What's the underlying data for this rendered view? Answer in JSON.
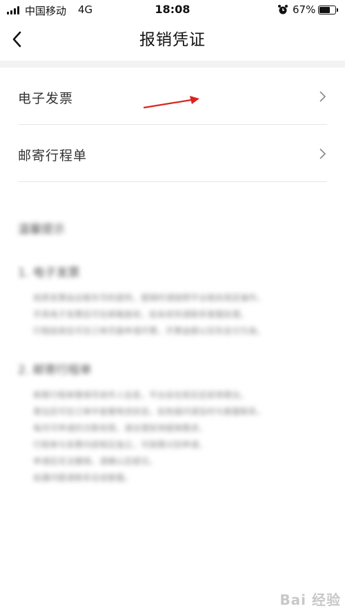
{
  "status_bar": {
    "carrier": "中国移动",
    "network": "4G",
    "time": "18:08",
    "battery_percent": "67%"
  },
  "nav": {
    "title": "报销凭证"
  },
  "list": [
    {
      "label": "电子发票"
    },
    {
      "label": "邮寄行程单"
    }
  ],
  "help": {
    "heading": "温馨提示",
    "sections": [
      {
        "title": "1. 电子发票",
        "lines": [
          "纸质发票由出租车司机提供，报销时请按照平台相关规定操作，",
          "开具电子发票后可在邮箱查收，如未收到请联系客服处理，",
          "行程结束后可在订单页面申请开票，开票金额以实际支付为准。"
        ]
      },
      {
        "title": "2. 邮寄行程单",
        "lines": [
          "邮寄行程单需填写收件人信息，平台会在核实后安排寄出，",
          "寄出后可在订单中查看物流状态，如有疑问请及时与客服联系，",
          "每月可申请的次数有限，请合理安排报销需求，",
          "行程单与发票内容相互独立，可按需分别申请，",
          "申请后无法撤销，请确认后提交。",
          "如遇问题请联系在线客服。"
        ]
      }
    ]
  },
  "watermark": "Bai 经验"
}
